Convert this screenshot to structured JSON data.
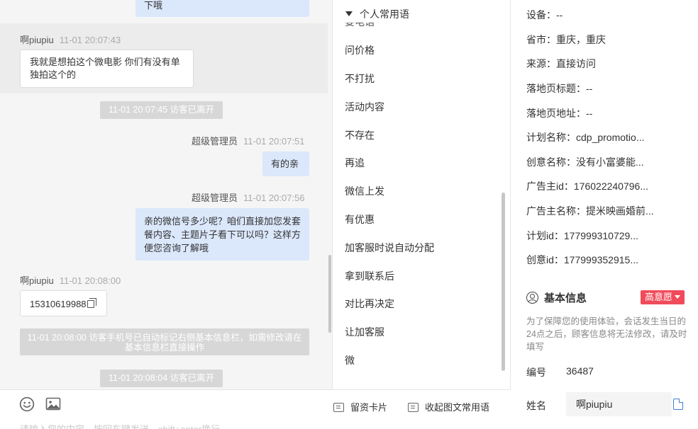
{
  "chat": {
    "partial_message": "下哦",
    "msg1": {
      "sender": "啊piupiu",
      "time": "11-01 20:07:43",
      "text": "我就是想拍这个微电影 你们有没有单独拍这个的"
    },
    "sys1": "11-01 20:07:45 访客已离开",
    "msg2": {
      "sender": "超级管理员",
      "time": "11-01 20:07:51",
      "text": "有的亲"
    },
    "msg3": {
      "sender": "超级管理员",
      "time": "11-01 20:07:56",
      "text": "亲的微信号多少呢？咱们直接加您发套餐内容、主题片子看下可以吗？这样方便您咨询了解哦"
    },
    "msg4": {
      "sender": "啊piupiu",
      "time": "11-01 20:08:00",
      "text": "15310619988"
    },
    "sys2": "11-01 20:08:00 访客手机号已自动标记右侧基本信息栏，如需修改请在基本信息栏直接操作",
    "sys3": "11-01 20:08:04 访客已离开"
  },
  "toolbar": {
    "emoji_icon": "smile-icon",
    "image_icon": "image-icon",
    "leave_card": "留资卡片",
    "collapse_phrases": "收起图文常用语",
    "input_placeholder": "请输入您的内容，按回车键发送，shift+enter换行"
  },
  "phrases": {
    "header": "个人常用语",
    "partial_item": "要电话",
    "items": [
      "问价格",
      "不打扰",
      "活动内容",
      "不存在",
      "再追",
      "微信上发",
      "有优惠",
      "加客服时说自动分配",
      "拿到联系后",
      "对比再决定",
      "让加客服",
      "微"
    ]
  },
  "info": {
    "device": "设备：--",
    "province": "省市：重庆，重庆",
    "source": "来源：直接访问",
    "landing_title": "落地页标题：--",
    "landing_url": "落地页地址：--",
    "plan_name": "计划名称：cdp_promotio...",
    "creative_name": "创意名称：没有小富婆能...",
    "advertiser_id": "广告主id：176022240796...",
    "advertiser_name": "广告主名称：提米映画婚前...",
    "plan_id": "计划id：177999310729...",
    "creative_id": "创意id：177999352915...",
    "basic_title": "基本信息",
    "intent_badge": "高意愿",
    "notice": "为了保障您的使用体验，会话发生当日的24点之后，顾客信息将无法修改，请及时填写",
    "number_label": "编号",
    "number_value": "36487",
    "name_label": "姓名",
    "name_value": "啊piupiu"
  },
  "colors": {
    "visitor_bubble": "#ffffff",
    "agent_bubble": "#dbe7fb",
    "system_notice": "#d7d7d7",
    "intent_badge": "#f04b5a",
    "copy_icon": "#3d7fd9"
  }
}
